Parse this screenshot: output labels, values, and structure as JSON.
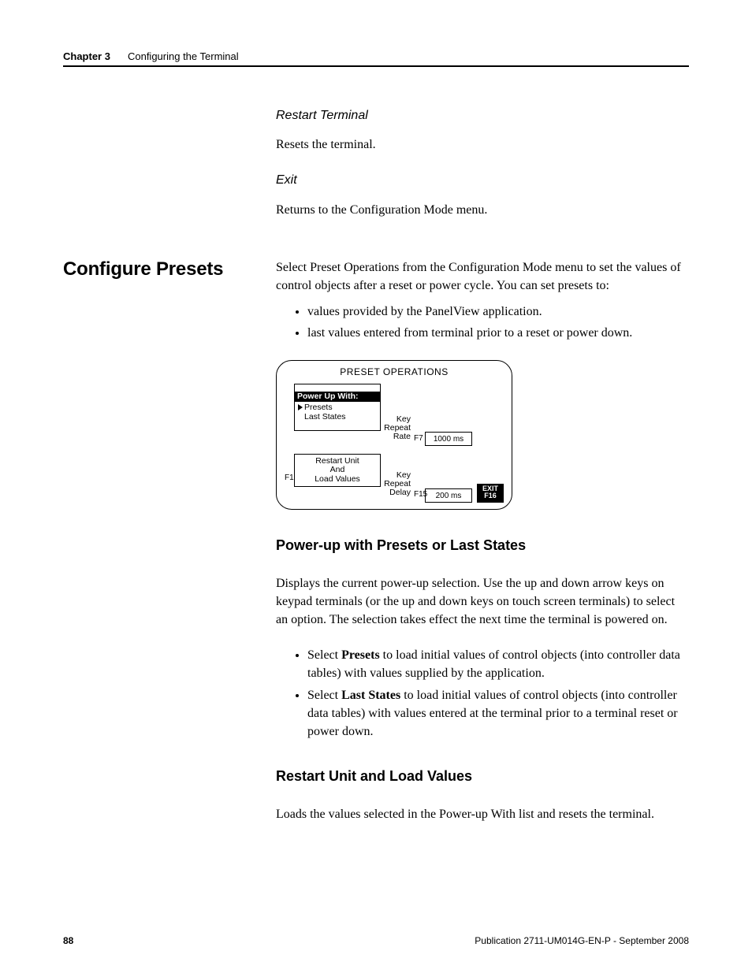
{
  "header": {
    "chapter": "Chapter 3",
    "title": "Configuring the Terminal"
  },
  "top_block": {
    "sub1": "Restart Terminal",
    "p1": "Resets the terminal.",
    "sub2": "Exit",
    "p2": "Returns to the Configuration Mode menu."
  },
  "section": {
    "heading": "Configure Presets",
    "intro": "Select Preset Operations from the Configuration Mode menu to set the values of control objects after a reset or power cycle. You can set presets to:",
    "bullets": [
      "values provided by the PanelView application.",
      "last values entered from terminal prior to a reset or power down."
    ]
  },
  "figure": {
    "title": "PRESET OPERATIONS",
    "powerup_header": "Power Up With:",
    "powerup_selected": "Presets",
    "powerup_option2": "Last States",
    "key_repeat_rate_label": "Key Repeat Rate",
    "key_repeat_rate_value": "1000 ms",
    "f7": "F7",
    "restart_label_l1": "Restart Unit",
    "restart_label_l2": "And",
    "restart_label_l3": "Load Values",
    "f1": "F1",
    "key_repeat_delay_label": "Key Repeat Delay",
    "key_repeat_delay_value": "200 ms",
    "f15": "F15",
    "exit_l1": "EXIT",
    "exit_l2": "F16"
  },
  "sub_powerup": {
    "heading": "Power-up with Presets or Last States",
    "para": "Displays the current power-up selection. Use the up and down arrow keys on keypad terminals (or the up and down keys on touch screen terminals) to select an option. The selection takes effect the next time the terminal is powered on.",
    "bullets": [
      {
        "lead": "Select ",
        "bold": "Presets",
        "tail": " to load initial values of control objects (into controller data tables) with values supplied by the application."
      },
      {
        "lead": "Select ",
        "bold": "Last States",
        "tail": " to load initial values of control objects (into controller data tables) with values entered at the terminal prior to a terminal reset or power down."
      }
    ]
  },
  "sub_restart": {
    "heading": "Restart Unit and Load Values",
    "para": "Loads the values selected in the Power-up With list and resets the terminal."
  },
  "footer": {
    "page": "88",
    "pub": "Publication 2711-UM014G-EN-P - September 2008"
  }
}
